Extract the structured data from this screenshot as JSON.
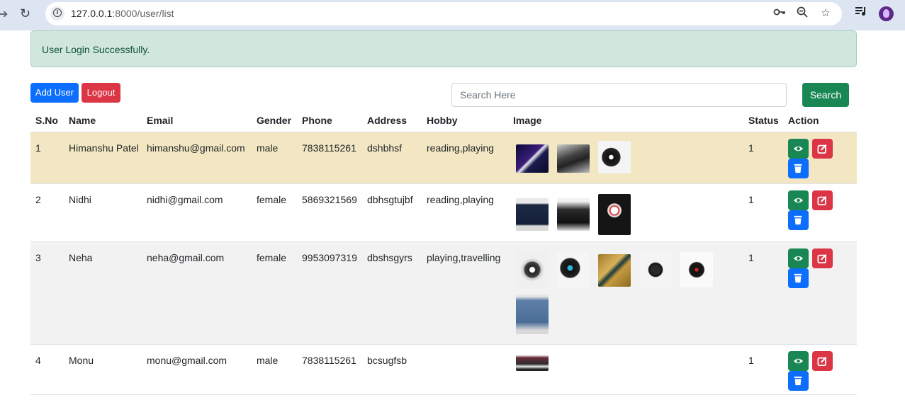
{
  "browser": {
    "url_host": "127.0.0.1",
    "url_path": ":8000/user/list"
  },
  "alert": {
    "message": "User Login Successfully."
  },
  "toolbar": {
    "add_label": "Add User",
    "logout_label": "Logout",
    "search_placeholder": "Search Here",
    "search_label": "Search"
  },
  "table": {
    "headers": [
      "S.No",
      "Name",
      "Email",
      "Gender",
      "Phone",
      "Address",
      "Hobby",
      "Image",
      "Status",
      "Action"
    ],
    "rows": [
      {
        "sno": "1",
        "name": "Himanshu Patel",
        "email": "himanshu@gmail.com",
        "gender": "male",
        "phone": "7838115261",
        "address": "dshbhsf",
        "hobby": "reading,playing",
        "status": "1",
        "image_count": 3
      },
      {
        "sno": "2",
        "name": "Nidhi",
        "email": "nidhi@gmail.com",
        "gender": "female",
        "phone": "5869321569",
        "address": "dbhsgtujbf",
        "hobby": "reading,playing",
        "status": "1",
        "image_count": 3
      },
      {
        "sno": "3",
        "name": "Neha",
        "email": "neha@gmail.com",
        "gender": "female",
        "phone": "9953097319",
        "address": "dbshsgyrs",
        "hobby": "playing,travelling",
        "status": "1",
        "image_count": 6
      },
      {
        "sno": "4",
        "name": "Monu",
        "email": "monu@gmail.com",
        "gender": "male",
        "phone": "7838115261",
        "address": "bcsugfsb",
        "hobby": "",
        "status": "1",
        "image_count": 1
      }
    ]
  },
  "colors": {
    "primary": "#0d6efd",
    "danger": "#dc3545",
    "success": "#198754",
    "alert_bg": "#d1e7dd",
    "highlight_row": "#f2e7c2"
  }
}
